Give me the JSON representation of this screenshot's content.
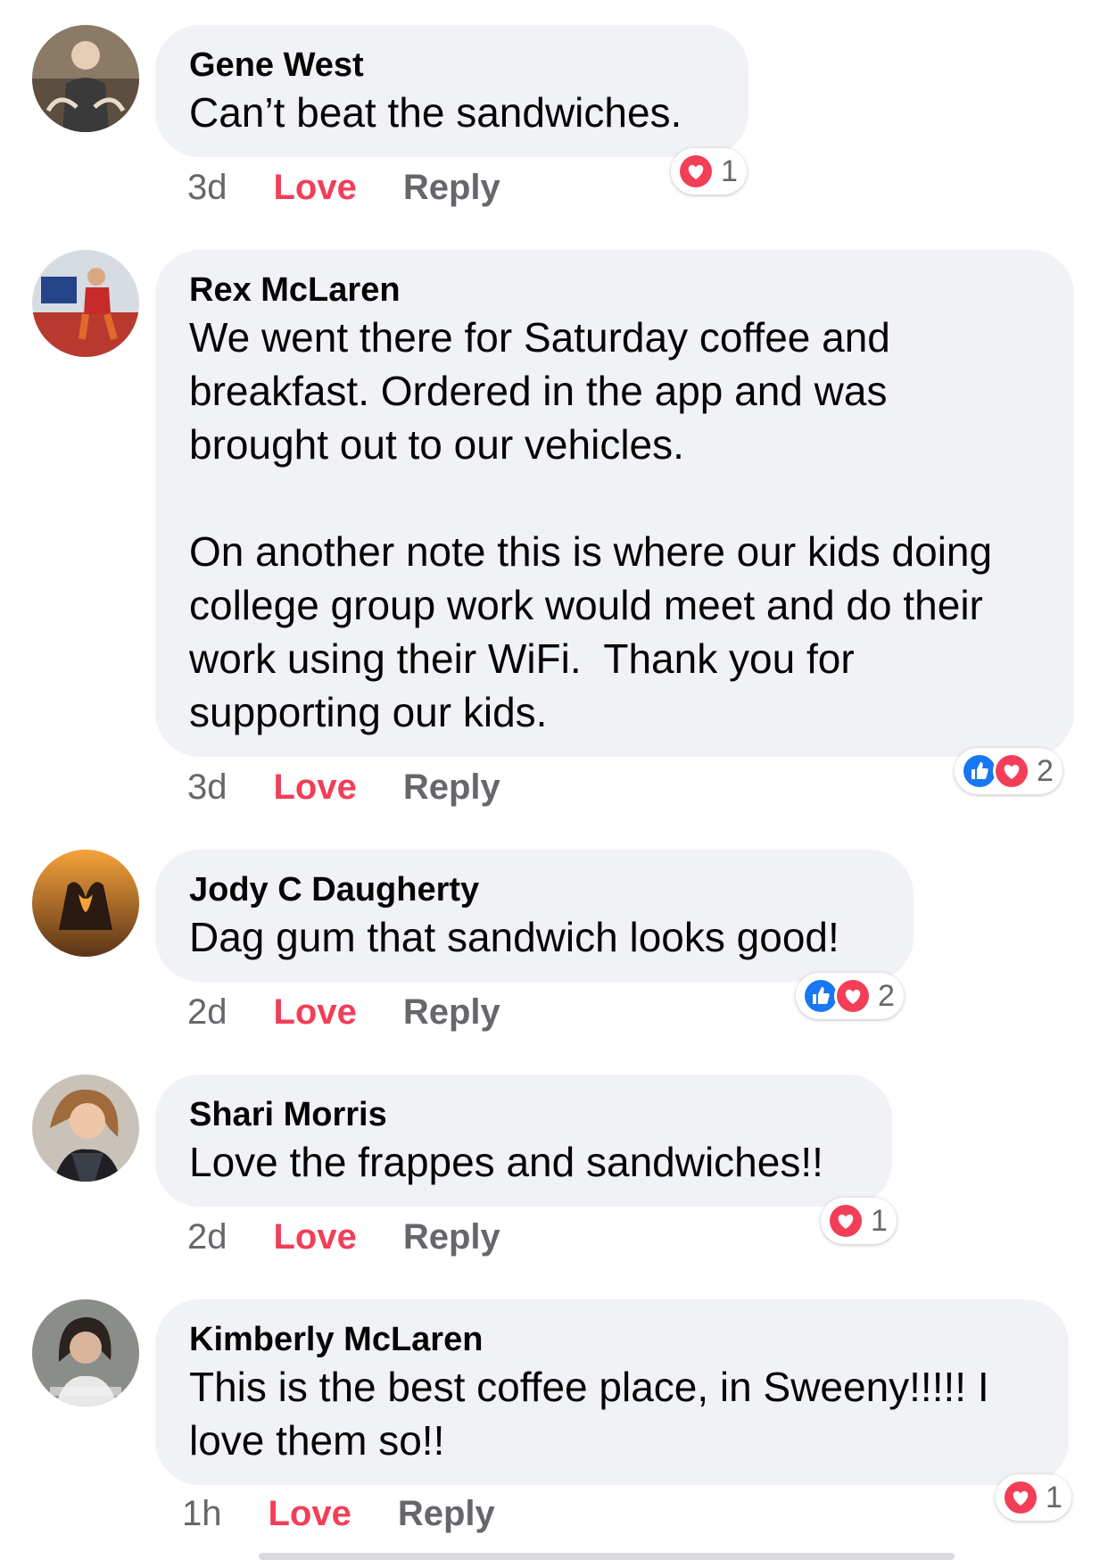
{
  "comments": [
    {
      "author": "Gene West",
      "text": "Can’t beat the sandwiches.",
      "time": "3d",
      "love": "Love",
      "reply": "Reply",
      "reactions": [
        "love"
      ],
      "count": "1"
    },
    {
      "author": "Rex McLaren",
      "text": "We went there for Saturday coffee and\nbreakfast. Ordered in the app and was\nbrought out to our vehicles.\n\nOn another note this is where our kids doing\ncollege group work would meet and do their\nwork using their WiFi.  Thank you for\nsupporting our kids.",
      "time": "3d",
      "love": "Love",
      "reply": "Reply",
      "reactions": [
        "like",
        "love"
      ],
      "count": "2"
    },
    {
      "author": "Jody C Daugherty",
      "text": "Dag gum that sandwich looks good!",
      "time": "2d",
      "love": "Love",
      "reply": "Reply",
      "reactions": [
        "like",
        "love"
      ],
      "count": "2"
    },
    {
      "author": "Shari Morris",
      "text": "Love the frappes and sandwiches!!",
      "time": "2d",
      "love": "Love",
      "reply": "Reply",
      "reactions": [
        "love"
      ],
      "count": "1"
    },
    {
      "author": "Kimberly McLaren",
      "text": "This is the best coffee place, in Sweeny!!!!! I\nlove them so!!",
      "time": "1h",
      "love": "Love",
      "reply": "Reply",
      "reactions": [
        "love"
      ],
      "count": "1"
    }
  ],
  "colors": {
    "love_accent": "#f33e58",
    "like_accent": "#1877f2",
    "bubble": "#f0f2f5",
    "meta_text": "#65676b"
  },
  "icons": {
    "love": "heart-reaction-icon",
    "like": "thumbs-up-reaction-icon"
  }
}
